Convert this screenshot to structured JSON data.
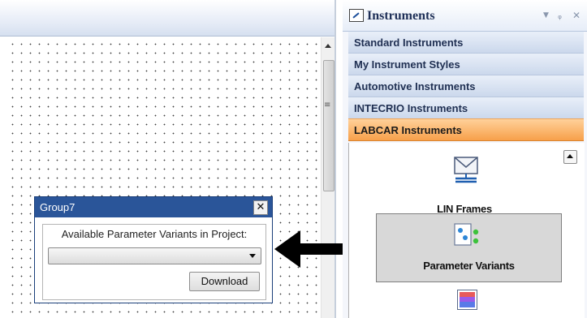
{
  "group_panel": {
    "title": "Group7",
    "close_glyph": "✕",
    "label": "Available Parameter Variants in Project:",
    "select_value": "",
    "download_label": "Download"
  },
  "instruments_panel": {
    "title": "Instruments",
    "header_controls": [
      "▼",
      "ᵩ",
      "✕"
    ],
    "categories": [
      {
        "label": "Standard Instruments",
        "active": false
      },
      {
        "label": "My Instrument Styles",
        "active": false
      },
      {
        "label": "Automotive Instruments",
        "active": false
      },
      {
        "label": "INTECRIO Instruments",
        "active": false
      },
      {
        "label": "LABCAR Instruments",
        "active": true
      }
    ],
    "items": [
      {
        "label": "LIN Frames",
        "icon": "envelope-network-icon"
      },
      {
        "label": "Parameter Variants",
        "icon": "parameter-variants-icon",
        "selected": true
      }
    ],
    "partial_item_icon": "color-grid-icon"
  },
  "designer": {
    "scrollbar_grip": "≡"
  },
  "colors": {
    "title_bar": "#2a5599",
    "active_category": "#f7a04a",
    "category": "#cbd8ec",
    "selected_item": "#d8d8d8"
  }
}
